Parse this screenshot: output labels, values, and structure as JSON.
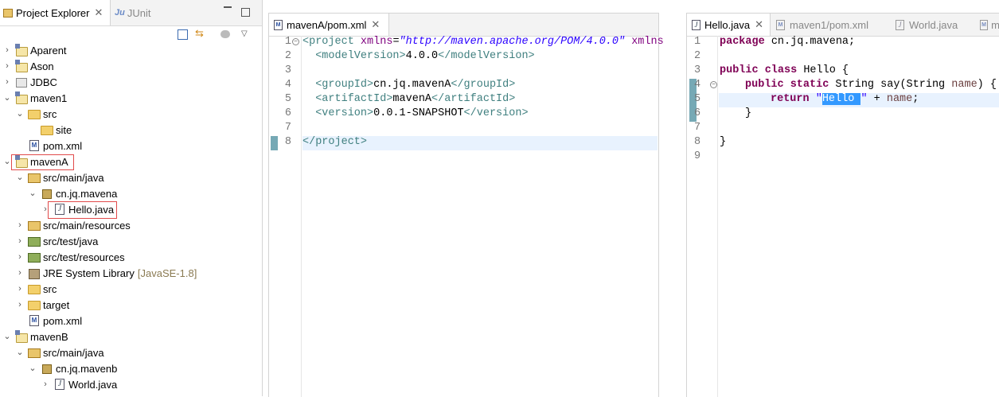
{
  "left_panel": {
    "tabs": [
      {
        "label": "Project Explorer",
        "close": "✕"
      },
      {
        "label": "JUnit",
        "prefix": "Ju"
      }
    ],
    "tree": [
      {
        "label": "Aparent",
        "icon": "project-icon",
        "expanded": false
      },
      {
        "label": "Ason",
        "icon": "project-icon",
        "expanded": false
      },
      {
        "label": "JDBC",
        "icon": "project-icon",
        "expanded": false
      },
      {
        "label": "maven1",
        "icon": "project-icon",
        "expanded": true
      },
      {
        "label": "src",
        "icon": "folder-icon",
        "expanded": true
      },
      {
        "label": "site",
        "icon": "folder-icon"
      },
      {
        "label": "pom.xml",
        "icon": "xml-file-icon"
      },
      {
        "label": "mavenA",
        "icon": "project-icon",
        "expanded": true
      },
      {
        "label": "src/main/java",
        "icon": "source-folder-icon",
        "expanded": true
      },
      {
        "label": "cn.jq.mavena",
        "icon": "package-icon",
        "expanded": true
      },
      {
        "label": "Hello.java",
        "icon": "java-file-icon",
        "expanded": false
      },
      {
        "label": "src/main/resources",
        "icon": "source-folder-icon",
        "expanded": false
      },
      {
        "label": "src/test/java",
        "icon": "test-folder-icon",
        "expanded": false
      },
      {
        "label": "src/test/resources",
        "icon": "test-folder-icon",
        "expanded": false
      },
      {
        "label": "JRE System Library",
        "decoration": "[JavaSE-1.8]",
        "icon": "library-icon",
        "expanded": false
      },
      {
        "label": "src",
        "icon": "folder-icon",
        "expanded": false
      },
      {
        "label": "target",
        "icon": "folder-icon",
        "expanded": false
      },
      {
        "label": "pom.xml",
        "icon": "xml-file-icon"
      },
      {
        "label": "mavenB",
        "icon": "project-icon",
        "expanded": true
      },
      {
        "label": "src/main/java",
        "icon": "source-folder-icon",
        "expanded": true
      },
      {
        "label": "cn.jq.mavenb",
        "icon": "package-icon",
        "expanded": true
      },
      {
        "label": "World.java",
        "icon": "java-file-icon",
        "expanded": false
      }
    ]
  },
  "middle_editor": {
    "tab": {
      "label": "mavenA/pom.xml",
      "close": "✕"
    },
    "line_numbers": [
      "1",
      "2",
      "3",
      "4",
      "5",
      "6",
      "7",
      "8"
    ],
    "lines": [
      {
        "t1": "<project ",
        "t2": "xmlns",
        "t3": "=",
        "t4": "\"http://maven.apache.org/POM/4.0.0\"",
        "t5": " xmlns"
      },
      {
        "t1": "  <modelVersion>",
        "t2": "4.0.0",
        "t3": "</modelVersion>"
      },
      {},
      {
        "t1": "  <groupId>",
        "t2": "cn.jq.mavenA",
        "t3": "</groupId>"
      },
      {
        "t1": "  <artifactId>",
        "t2": "mavenA",
        "t3": "</artifactId>"
      },
      {
        "t1": "  <version>",
        "t2": "0.0.1-SNAPSHOT",
        "t3": "</version>"
      },
      {},
      {
        "t1": "</project>"
      }
    ]
  },
  "right_editor": {
    "tabs": [
      {
        "label": "Hello.java",
        "close": "✕"
      },
      {
        "label": "maven1/pom.xml"
      },
      {
        "label": "World.java"
      },
      {
        "label": "m"
      }
    ],
    "line_numbers": [
      "1",
      "2",
      "3",
      "4",
      "5",
      "6",
      "7",
      "8",
      "9"
    ],
    "code": {
      "l1_kw": "package",
      "l1_rest": " cn.jq.mavena;",
      "l3_kw": "public class",
      "l3_rest": " Hello {",
      "l4_kw": "public static",
      "l4_rest": " String say(String ",
      "l4_param": "name",
      "l4_end": ") {",
      "l5_kw": "return",
      "l5_q1": "\"",
      "l5_sel": "Hello ",
      "l5_q2": "\"",
      "l5_rest": " + ",
      "l5_var": "name",
      "l5_end": ";",
      "l6": "}",
      "l8": "}"
    }
  },
  "colors": {
    "selection": "#3399ff",
    "current_line": "#e8f2fe",
    "gutter_marker": "#76a9b5",
    "highlight_box": "#e14b4b"
  }
}
